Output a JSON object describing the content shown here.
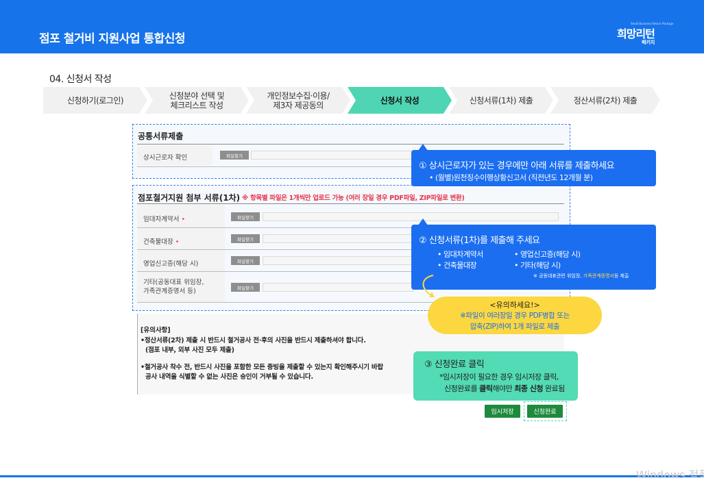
{
  "header": {
    "title": "점포 철거비 지원사업 통합신청",
    "logo_text": "희망리턴",
    "logo_sub": "패키지",
    "logo_tiny": "Small Business Return Package"
  },
  "section": {
    "title": "04. 신청서 작성"
  },
  "steps": [
    {
      "label": "신청하기(로그인)"
    },
    {
      "label_line1": "신청분야 선택 및",
      "label_line2": "체크리스트 작성"
    },
    {
      "label_line1": "개인정보수집·이용/",
      "label_line2": "제3자 제공동의"
    },
    {
      "label": "신청서 작성"
    },
    {
      "label": "신청서류(1차) 제출"
    },
    {
      "label": "정산서류(2차) 제출"
    }
  ],
  "common_docs": {
    "heading": "공통서류제출",
    "rows": [
      {
        "label": "상시근로자 확인",
        "button": "파일찾기"
      }
    ]
  },
  "attach_docs": {
    "heading": "점포철거지원 첨부 서류(1차)",
    "notice": "※ 항목별 파일은 1개씩만 업로드 가능 (여러 장일 경우 PDF파일, ZIP파일로 변환)",
    "rows": [
      {
        "label": "임대차계약서",
        "required": "•",
        "button": "파일찾기"
      },
      {
        "label": "건축물대장",
        "required": "•",
        "button": "파일찾기"
      },
      {
        "label": "영업신고증(해당 시)",
        "button": "파일찾기"
      },
      {
        "label_line1": "기타(공동대표 위임장,",
        "label_line2": "가족관계증명서 등)",
        "button": "파일찾기"
      }
    ]
  },
  "notes": {
    "title": "[유의사항]",
    "line1": "•정산서류(2차) 제출 시 반드시 철거공사 전·후의 사진을 반드시 제출하셔야 합니다.",
    "line2": "(점포 내부, 외부 사진 모두 제출)",
    "line3": "•철거공사 착수 전, 반드시 사진을 포함한 모든 증빙을 제출할 수 있는지 확인해주시기 바랍",
    "line4": "공사 내역을 식별할 수 없는 사진은 승인이 거부될 수 있습니다."
  },
  "callout1": {
    "title": "① 상시근로자가 있는 경우에만 아래 서류를 제출하세요",
    "line": "• (월별)원천징수이행상황신고서 (직전년도 12개월 분)"
  },
  "callout2": {
    "title": "② 신청서류(1차)를 제출해 주세요",
    "item1": "• 임대차계약서",
    "item2": "• 건축물대장",
    "item3": "• 영업신고증(해당 시)",
    "item4": "• 기타(해당 시)",
    "small_prefix": "※ 공동대표관련 위임장,",
    "small_highlight": "가족관계증명서",
    "small_suffix": "등 제출"
  },
  "warning": {
    "title": "<유의하세요!>",
    "line1": "※파일이 여러장일 경우 PDF병합 또는",
    "line2": "압축(ZIP)하여 1개 파일로 제출"
  },
  "callout3": {
    "title": "③ 신청완료 클릭",
    "line1": "*임시저장이 필요한 경우 임시저장 클릭,",
    "line2_prefix": "신청완료를",
    "line2_bold1": "클릭",
    "line2_mid": "해야만",
    "line2_bold2": "최종 신청",
    "line2_suffix": "완료됨"
  },
  "buttons": {
    "temp_save": "임시저장",
    "submit": "신청완료"
  },
  "watermark": "Windows 정품"
}
